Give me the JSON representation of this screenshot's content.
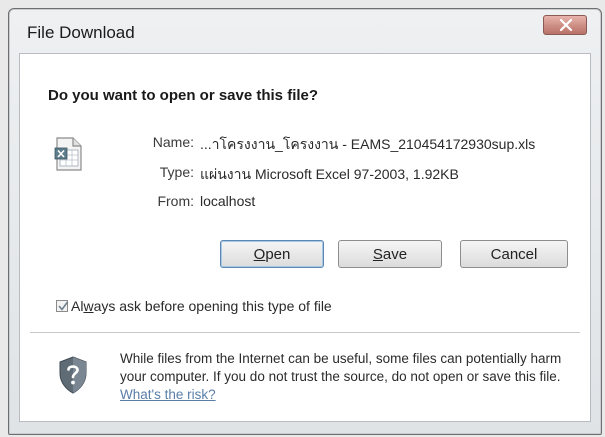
{
  "window": {
    "title": "File Download",
    "close_icon": "close-icon"
  },
  "dialog": {
    "question": "Do you want to open or save this file?",
    "file_icon": "excel-file-icon",
    "name_label": "Name:",
    "name_value": "...าโครงงาน_โครงงาน - EAMS_210454172930sup.xls",
    "type_label": "Type:",
    "type_value": "แผ่นงาน Microsoft Excel 97-2003, 1.92KB",
    "from_label": "From:",
    "from_value": "localhost"
  },
  "buttons": {
    "open": {
      "mnemonic": "O",
      "rest": "pen"
    },
    "save": {
      "mnemonic": "S",
      "rest": "ave"
    },
    "cancel": "Cancel"
  },
  "checkbox": {
    "checked": true,
    "label_mnemonic": "w",
    "label_before": "Al",
    "label_after": "ays ask before opening this type of file"
  },
  "warning": {
    "icon": "shield-question-icon",
    "text": "While files from the Internet can be useful, some files can potentially harm your computer. If you do not trust the source, do not open or save this file.",
    "link": "What's the risk?"
  },
  "colors": {
    "link": "#5a7ea8",
    "close_button": "#c98a80"
  }
}
